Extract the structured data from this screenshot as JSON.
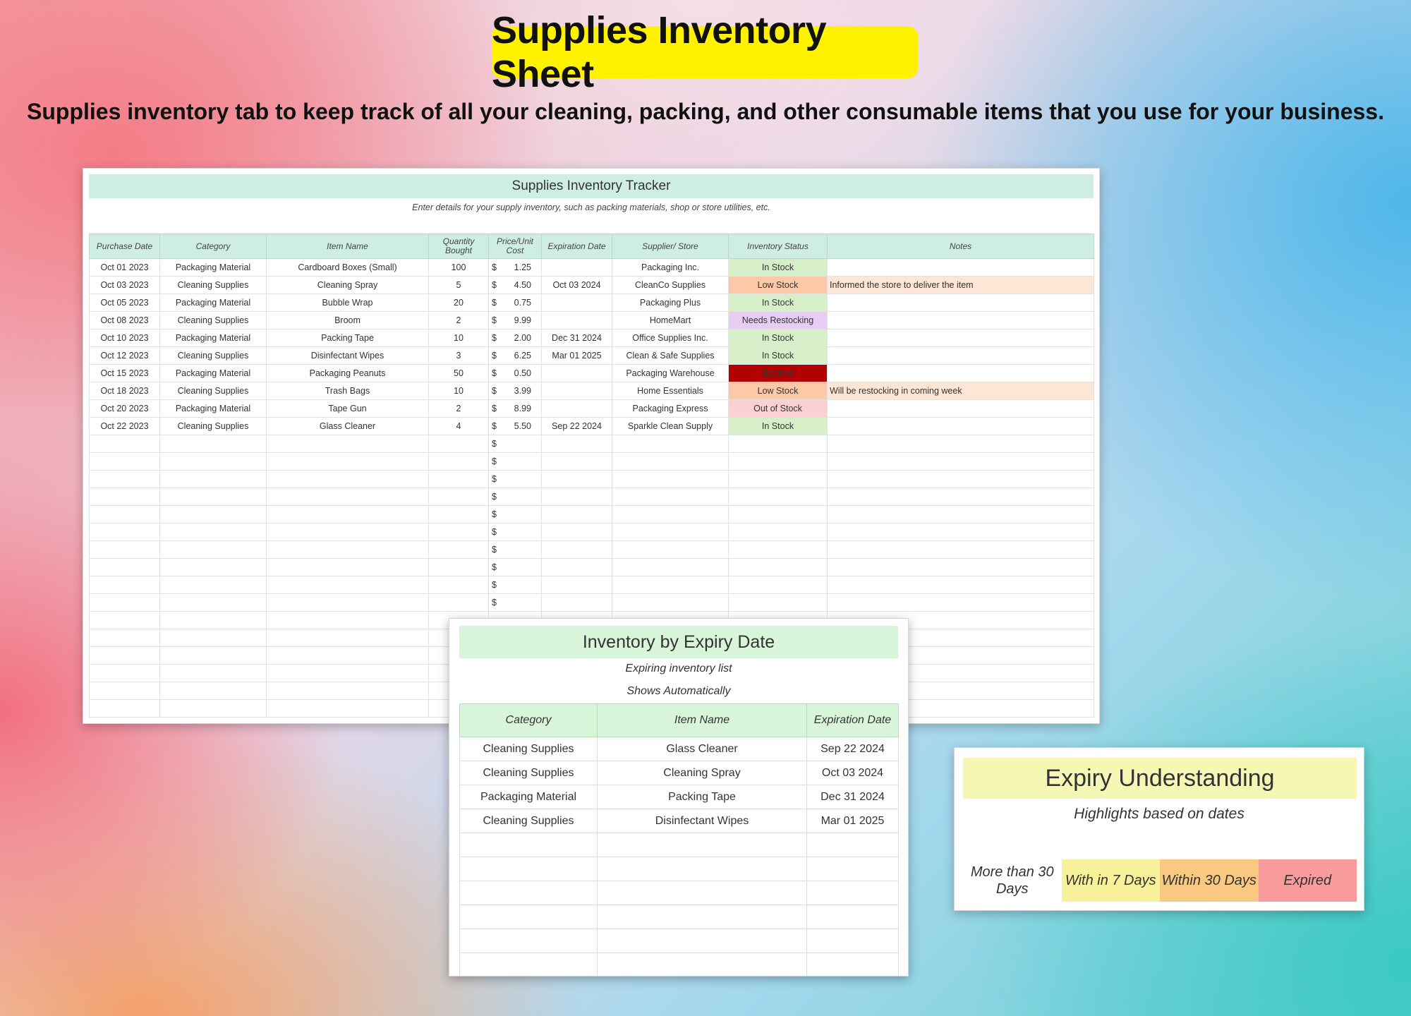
{
  "header": {
    "title": "Supplies Inventory Sheet",
    "subtitle": "Supplies inventory tab to keep track of all your cleaning, packing, and other consumable items that you use for your business."
  },
  "tracker": {
    "title": "Supplies Inventory Tracker",
    "instructions": "Enter details for your supply inventory, such as packing materials, shop or store utilities, etc.",
    "columns": [
      "Purchase Date",
      "Category",
      "Item Name",
      "Quantity Bought",
      "Price/Unit Cost",
      "Expiration Date",
      "Supplier/ Store",
      "Inventory Status",
      "Notes"
    ],
    "currency_symbol": "$",
    "rows": [
      {
        "date": "Oct 01 2023",
        "category": "Packaging Material",
        "item": "Cardboard Boxes (Small)",
        "qty": "100",
        "price": "1.25",
        "expiry": "",
        "supplier": "Packaging Inc.",
        "status": "In Stock",
        "status_type": "in",
        "notes": ""
      },
      {
        "date": "Oct 03 2023",
        "category": "Cleaning Supplies",
        "item": "Cleaning Spray",
        "qty": "5",
        "price": "4.50",
        "expiry": "Oct 03 2024",
        "supplier": "CleanCo Supplies",
        "status": "Low Stock",
        "status_type": "low",
        "notes": "Informed the store to deliver the item"
      },
      {
        "date": "Oct 05 2023",
        "category": "Packaging Material",
        "item": "Bubble Wrap",
        "qty": "20",
        "price": "0.75",
        "expiry": "",
        "supplier": "Packaging Plus",
        "status": "In Stock",
        "status_type": "in",
        "notes": ""
      },
      {
        "date": "Oct 08 2023",
        "category": "Cleaning Supplies",
        "item": "Broom",
        "qty": "2",
        "price": "9.99",
        "expiry": "",
        "supplier": "HomeMart",
        "status": "Needs Restocking",
        "status_type": "need",
        "notes": ""
      },
      {
        "date": "Oct 10 2023",
        "category": "Packaging Material",
        "item": "Packing Tape",
        "qty": "10",
        "price": "2.00",
        "expiry": "Dec 31 2024",
        "supplier": "Office Supplies Inc.",
        "status": "In Stock",
        "status_type": "in",
        "notes": ""
      },
      {
        "date": "Oct 12 2023",
        "category": "Cleaning Supplies",
        "item": "Disinfectant Wipes",
        "qty": "3",
        "price": "6.25",
        "expiry": "Mar 01 2025",
        "supplier": "Clean & Safe Supplies",
        "status": "In Stock",
        "status_type": "in",
        "notes": ""
      },
      {
        "date": "Oct 15 2023",
        "category": "Packaging Material",
        "item": "Packaging Peanuts",
        "qty": "50",
        "price": "0.50",
        "expiry": "",
        "supplier": "Packaging Warehouse",
        "status": "Expired",
        "status_type": "exp",
        "notes": ""
      },
      {
        "date": "Oct 18 2023",
        "category": "Cleaning Supplies",
        "item": "Trash Bags",
        "qty": "10",
        "price": "3.99",
        "expiry": "",
        "supplier": "Home Essentials",
        "status": "Low Stock",
        "status_type": "low",
        "notes": "Will be restocking in coming week"
      },
      {
        "date": "Oct 20 2023",
        "category": "Packaging Material",
        "item": "Tape Gun",
        "qty": "2",
        "price": "8.99",
        "expiry": "",
        "supplier": "Packaging Express",
        "status": "Out of Stock",
        "status_type": "out",
        "notes": ""
      },
      {
        "date": "Oct 22 2023",
        "category": "Cleaning Supplies",
        "item": "Glass Cleaner",
        "qty": "4",
        "price": "5.50",
        "expiry": "Sep 22 2024",
        "supplier": "Sparkle Clean Supply",
        "status": "In Stock",
        "status_type": "in",
        "notes": ""
      }
    ],
    "empty_rows_with_dollar": 10,
    "empty_rows_plain": 6
  },
  "expiry_panel": {
    "title": "Inventory by Expiry Date",
    "subtitle1": "Expiring inventory list",
    "subtitle2": "Shows Automatically",
    "columns": [
      "Category",
      "Item Name",
      "Expiration Date"
    ],
    "rows": [
      {
        "category": "Cleaning Supplies",
        "item": "Glass Cleaner",
        "date": "Sep 22 2024"
      },
      {
        "category": "Cleaning Supplies",
        "item": "Cleaning Spray",
        "date": "Oct 03 2024"
      },
      {
        "category": "Packaging Material",
        "item": "Packing Tape",
        "date": "Dec 31 2024"
      },
      {
        "category": "Cleaning Supplies",
        "item": "Disinfectant Wipes",
        "date": "Mar 01 2025"
      }
    ],
    "empty_rows": 7
  },
  "understanding": {
    "title": "Expiry Understanding",
    "subtitle": "Highlights based on dates",
    "legend": [
      "More than 30 Days",
      "With in 7 Days",
      "Within 30 Days",
      "Expired"
    ],
    "legend_colors": [
      "#ffffff",
      "#f7f19a",
      "#f9c982",
      "#f89c9c"
    ]
  }
}
